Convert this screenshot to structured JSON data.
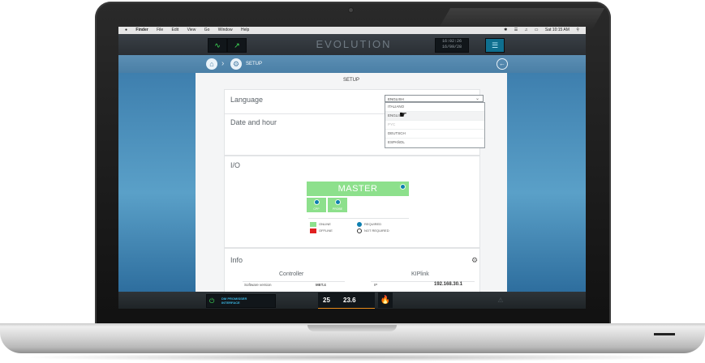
{
  "menubar": {
    "app": "Finder",
    "items": [
      "File",
      "Edit",
      "View",
      "Go",
      "Window",
      "Help"
    ],
    "clock": "Sat 10:15 AM"
  },
  "appbar": {
    "brand": "EVOLUTION",
    "clock_line1": "16:02:26",
    "clock_line2": "16/09/28"
  },
  "breadcrumb": {
    "label": "SETUP"
  },
  "panel": {
    "title": "SETUP",
    "language": {
      "label": "Language",
      "selected": "ENGLISH",
      "options": [
        "ITALIANO",
        "ENGLISH",
        "PYC",
        "DEUTSCH",
        "ESPAÑOL"
      ]
    },
    "date": {
      "label": "Date and hour"
    },
    "io": {
      "label": "I/O",
      "master": "MASTER",
      "boxes": [
        "CPP",
        "PROBE"
      ],
      "legend": {
        "online": "ONLINE",
        "offline": "OFFLINE",
        "required": "REQUIRED",
        "not_required": "NOT REQUIRED"
      }
    },
    "info": {
      "label": "Info",
      "controller": "Controller",
      "kiplink": "KIPlink",
      "software_label": "Software version",
      "software_value": "MET.4",
      "ip_label": "IP",
      "ip_value": "192.168.30.1"
    }
  },
  "bottombar": {
    "ui_line1": "DM PROMISSER",
    "ui_line2": "INTERFACE",
    "temp1": "25",
    "temp2": "23.6"
  },
  "colors": {
    "accent_green": "#3fe35a",
    "panel_green": "#8de08c",
    "offline_red": "#e02020",
    "required_blue": "#0e7fb0",
    "header_blue": "#4a7fa6"
  }
}
